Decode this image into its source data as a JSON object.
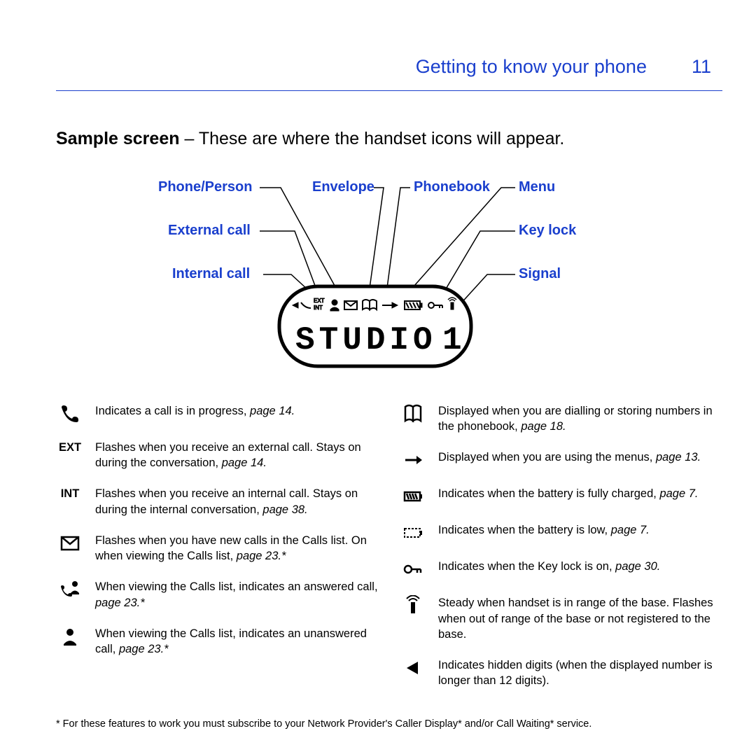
{
  "header": {
    "section": "Getting to know your phone",
    "page_number": "11"
  },
  "intro": {
    "lead": "Sample screen",
    "rest": " – These are where the handset icons will appear."
  },
  "callouts": {
    "phone_person": "Phone/Person",
    "envelope": "Envelope",
    "phonebook": "Phonebook",
    "menu": "Menu",
    "external_call": "External call",
    "key_lock": "Key lock",
    "internal_call": "Internal call",
    "signal": "Signal"
  },
  "lcd": {
    "name": "STUDIO",
    "num": "1",
    "ext": "EXT",
    "int": "INT"
  },
  "legend": {
    "left": [
      {
        "kind": "icon",
        "icon": "phone",
        "text": "Indicates a call is in progress, ",
        "ref": "page 14."
      },
      {
        "kind": "text",
        "label": "EXT",
        "text": "Flashes when you receive an external call. Stays on during the conversation, ",
        "ref": "page 14."
      },
      {
        "kind": "text",
        "label": "INT",
        "text": "Flashes when you receive an internal call. Stays on during the internal conversation, ",
        "ref": "page 38."
      },
      {
        "kind": "icon",
        "icon": "envelope",
        "text": "Flashes when you have new calls in the Calls list. On when viewing the Calls list, ",
        "ref": "page 23.*"
      },
      {
        "kind": "icon",
        "icon": "phone-person",
        "text": "When viewing the Calls list, indicates an answered call, ",
        "ref": "page 23.*"
      },
      {
        "kind": "icon",
        "icon": "person",
        "text": "When viewing the Calls list, indicates an unanswered call, ",
        "ref": "page 23.*"
      }
    ],
    "right": [
      {
        "kind": "icon",
        "icon": "book",
        "text": "Displayed when you are dialling or storing numbers in the phonebook, ",
        "ref": "page 18."
      },
      {
        "kind": "icon",
        "icon": "arrow-right",
        "text": "Displayed when you are using the menus, ",
        "ref": "page 13."
      },
      {
        "kind": "icon",
        "icon": "battery-full",
        "text": "Indicates when the battery is fully charged, ",
        "ref": "page 7."
      },
      {
        "kind": "icon",
        "icon": "battery-low",
        "text": "Indicates when the battery is low, ",
        "ref": "page 7."
      },
      {
        "kind": "icon",
        "icon": "key-lock",
        "text": "Indicates when the Key lock is on, ",
        "ref": "page 30."
      },
      {
        "kind": "icon",
        "icon": "signal",
        "text": "Steady when handset is in range of the base. Flashes when out of range of the base or not registered to the base.",
        "ref": ""
      },
      {
        "kind": "icon",
        "icon": "triangle-left",
        "text": "Indicates hidden digits (when the displayed number is longer than 12 digits).",
        "ref": ""
      }
    ]
  },
  "footnote": "*  For these features to work you must subscribe to your Network Provider's Caller Display* and/or Call Waiting* service."
}
